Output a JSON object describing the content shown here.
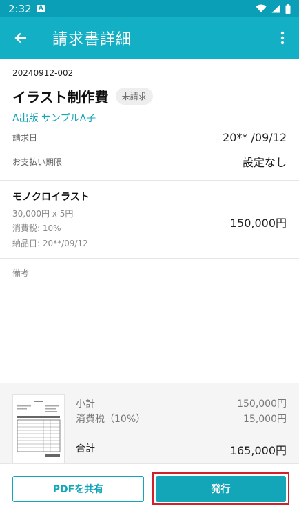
{
  "status_bar": {
    "time": "2:32",
    "notif_icon": "A"
  },
  "app_bar": {
    "title": "請求書詳細"
  },
  "invoice": {
    "number": "20240912-002",
    "title": "イラスト制作費",
    "status": "未請求",
    "client": "A出版 サンプルA子",
    "issue_date_label": "請求日",
    "issue_date_value": "20** /09/12",
    "due_label": "お支払い期限",
    "due_value": "設定なし"
  },
  "item": {
    "name": "モノクロイラスト",
    "quantity": "30,000円 x 5円",
    "tax": "消費税: 10%",
    "delivery": "納品日: 20**/09/12",
    "amount": "150,000円"
  },
  "memo": {
    "label": "備考"
  },
  "summary": {
    "subtotal_label": "小計",
    "subtotal_value": "150,000円",
    "tax_label": "消費税（10%）",
    "tax_value": "15,000円",
    "total_label": "合計",
    "total_value": "165,000円"
  },
  "actions": {
    "share_label": "PDFを共有",
    "issue_label": "発行"
  },
  "colors": {
    "status_bar": "#0a9fb6",
    "app_bar": "#13b0c5",
    "accent": "#13a5b8",
    "highlight": "#d0202c"
  },
  "icons": {
    "back": "arrow-left-icon",
    "more": "more-vert-icon",
    "wifi": "wifi-icon",
    "signal": "signal-icon",
    "battery": "battery-icon"
  }
}
